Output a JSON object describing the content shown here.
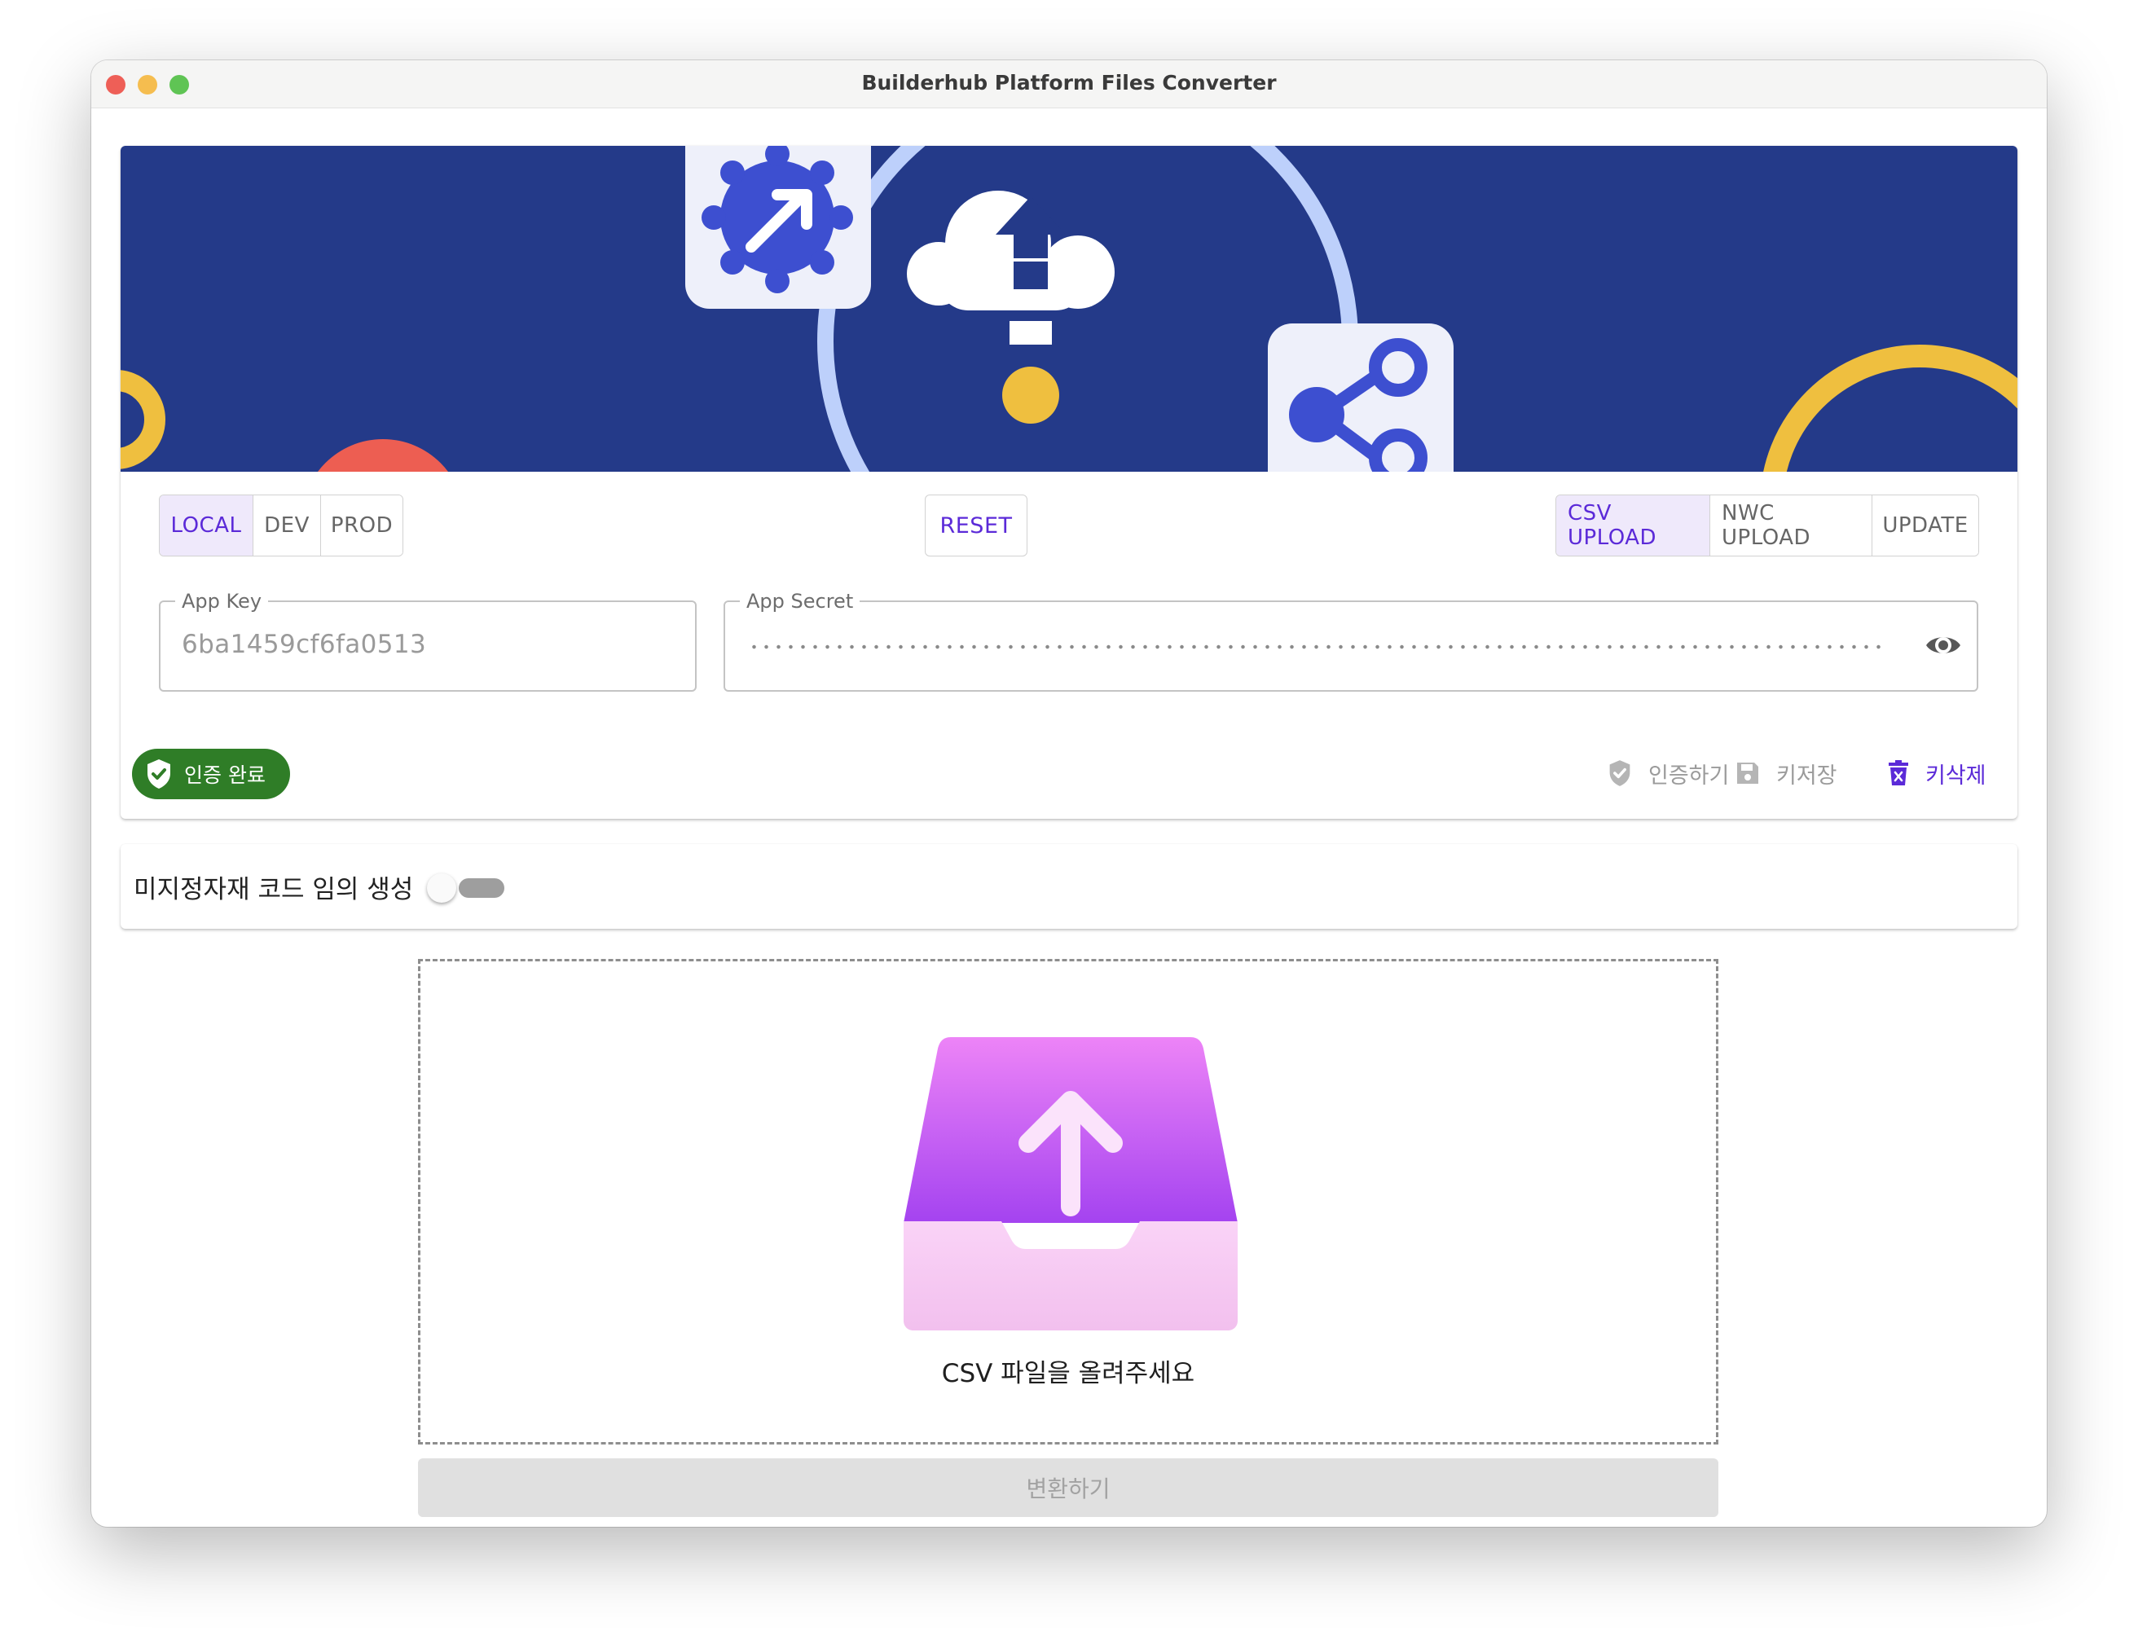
{
  "window": {
    "title": "Builderhub Platform Files Converter"
  },
  "environments": [
    {
      "label": "LOCAL",
      "active": true
    },
    {
      "label": "DEV",
      "active": false
    },
    {
      "label": "PROD",
      "active": false
    }
  ],
  "reset_label": "RESET",
  "modes": [
    {
      "label": "CSV UPLOAD",
      "active": true
    },
    {
      "label": "NWC UPLOAD",
      "active": false
    },
    {
      "label": "UPDATE",
      "active": false
    }
  ],
  "app_key": {
    "label": "App Key",
    "value": "6ba1459cf6fa0513"
  },
  "app_secret": {
    "label": "App Secret",
    "value_masked": true,
    "toggle_icon": "eye-icon"
  },
  "auth_badge": {
    "label": "인증 완료",
    "icon": "shield-check-icon",
    "color": "#2f7d27"
  },
  "actions": {
    "verify": {
      "label": "인증하기",
      "icon": "shield-check-icon"
    },
    "save": {
      "label": "키저장",
      "icon": "floppy-icon"
    },
    "delete": {
      "label": "키삭제",
      "icon": "trash-icon"
    }
  },
  "option": {
    "label": "미지정자재 코드 임의 생성",
    "enabled": false
  },
  "dropzone": {
    "text": "CSV 파일을 올려주세요",
    "icon": "inbox-upload-icon"
  },
  "convert_label": "변환하기",
  "colors": {
    "accent": "#5b2ad8",
    "banner": "#243a89",
    "success": "#2f7d27",
    "yellow": "#efbf3f",
    "red": "#ed5e52"
  }
}
